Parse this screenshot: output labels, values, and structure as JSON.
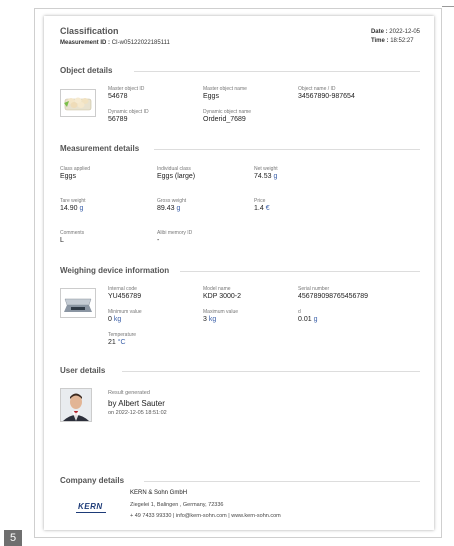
{
  "header": {
    "title": "Classification",
    "measurement_id_label": "Measurement ID :",
    "measurement_id": "CI-w05122022185111",
    "date_label": "Date :",
    "date": "2022-12-05",
    "time_label": "Time :",
    "time": "18:52:27"
  },
  "object_details": {
    "title": "Object details",
    "master_id_label": "Master object ID",
    "master_id": "54678",
    "master_name_label": "Master object name",
    "master_name": "Eggs",
    "object_name_label": "Object name / ID",
    "object_name": "34567890-987654",
    "dynamic_id_label": "Dynamic object ID",
    "dynamic_id": "56789",
    "dynamic_name_label": "Dynamic object name",
    "dynamic_name": "Orderid_7689"
  },
  "measurement_details": {
    "title": "Measurement details",
    "class_label": "Class applied",
    "class_value": "Eggs",
    "indiv_label": "Individual class",
    "indiv_value": "Eggs (large)",
    "net_label": "Net weight",
    "net_value": "74.53",
    "net_unit": "g",
    "tare_label": "Tare weight",
    "tare_value": "14.90",
    "tare_unit": "g",
    "gross_label": "Gross weight",
    "gross_value": "89.43",
    "gross_unit": "g",
    "price_label": "Price",
    "price_value": "1.4",
    "price_unit": "€",
    "comments_label": "Comments",
    "comments_value": "L",
    "alibi_label": "Alibi memory ID",
    "alibi_value": "-"
  },
  "device": {
    "title": "Weighing device information",
    "internal_label": "Internal code",
    "internal_value": "YU456789",
    "model_label": "Model name",
    "model_value": "KDP 3000-2",
    "serial_label": "Serial number",
    "serial_value": "456789098765456789",
    "min_label": "Minimum value",
    "min_value": "0",
    "min_unit": "kg",
    "max_label": "Maximum value",
    "max_value": "3",
    "max_unit": "kg",
    "d_label": "d",
    "d_value": "0.01",
    "d_unit": "g",
    "temp_label": "Temperature",
    "temp_value": "21",
    "temp_unit": "°C"
  },
  "user": {
    "title": "User details",
    "result_label": "Result generated",
    "by_text": "by Albert Sauter",
    "on_text": "on 2022-12-05 18:51:02"
  },
  "company": {
    "title": "Company details",
    "logo_text": "KERN",
    "name": "KERN & Sohn GmbH",
    "address": "Ziegelei 1, Balingen , Germany, 72336",
    "contact": "+ 49 7433 99330 | info@kern-sohn.com | www.kern-sohn.com"
  },
  "page_number": "5"
}
